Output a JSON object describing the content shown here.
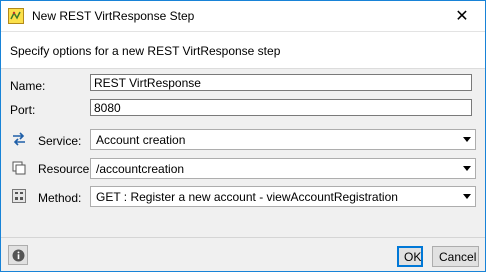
{
  "window": {
    "title": "New REST VirtResponse Step",
    "close_glyph": "✕"
  },
  "header": {
    "description": "Specify options for a new REST VirtResponse step"
  },
  "form": {
    "name": {
      "label": "Name:",
      "value": "REST VirtResponse"
    },
    "port": {
      "label": "Port:",
      "value": "8080"
    },
    "service": {
      "label": "Service:",
      "icon": "service-arrows-icon",
      "value": "Account creation"
    },
    "resource": {
      "label": "Resource:",
      "icon": "resource-icon",
      "value": "/accountcreation"
    },
    "method": {
      "label": "Method:",
      "icon": "rest-method-icon",
      "value": "GET : Register a new account - viewAccountRegistration"
    }
  },
  "footer": {
    "info_icon": "info-icon",
    "ok_label": "OK",
    "cancel_label": "Cancel"
  },
  "colors": {
    "accent": "#0078d7",
    "service_icon": "#1f5fa8"
  }
}
